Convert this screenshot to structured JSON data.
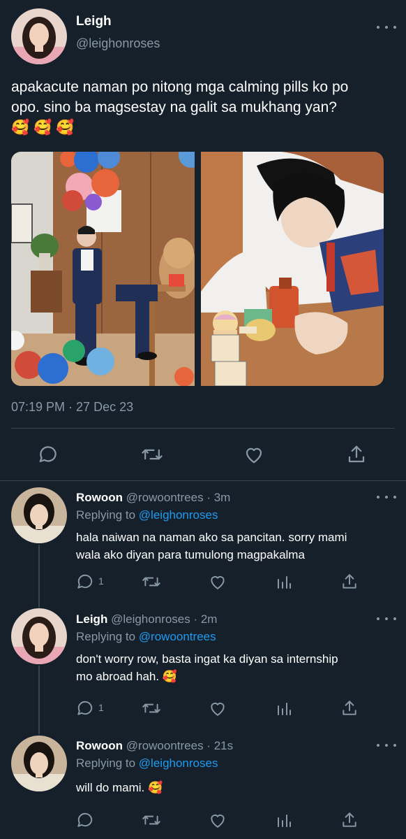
{
  "main_tweet": {
    "display_name": "Leigh",
    "handle": "@leighonroses",
    "text_line1": "apakacute naman po nitong mga calming pills ko po",
    "text_line2": "opo. sino ba magsestay na galit sa mukhang yan?",
    "emojis": "🥰 🥰 🥰",
    "timestamp": "07:19 PM · 27 Dec 23"
  },
  "replies": [
    {
      "display_name": "Rowoon",
      "handle": "@rowoontrees",
      "time": "· 3m",
      "replying_label": "Replying to",
      "replying_to": "@leighonroses",
      "text_line1": "hala naiwan na naman ako sa pancitan. sorry mami",
      "text_line2": "wala ako diyan para tumulong magpakalma",
      "reply_count": "1"
    },
    {
      "display_name": "Leigh",
      "handle": "@leighonroses",
      "time": "· 2m",
      "replying_label": "Replying to",
      "replying_to": "@rowoontrees",
      "text_line1": "don't worry row, basta ingat ka diyan sa internship",
      "text_line2": "mo abroad hah. 🥰",
      "reply_count": "1"
    },
    {
      "display_name": "Rowoon",
      "handle": "@rowoontrees",
      "time": "· 21s",
      "replying_label": "Replying to",
      "replying_to": "@leighonroses",
      "text_line1": "will do mami. 🥰",
      "text_line2": "",
      "reply_count": ""
    }
  ],
  "icons": {
    "reply": "reply-icon",
    "retweet": "retweet-icon",
    "like": "heart-icon",
    "analytics": "analytics-icon",
    "share": "share-icon",
    "more": "more-icon"
  },
  "colors": {
    "background": "#15202b",
    "muted": "#8899a6",
    "link": "#1d9bf0",
    "divider": "#38444d"
  }
}
